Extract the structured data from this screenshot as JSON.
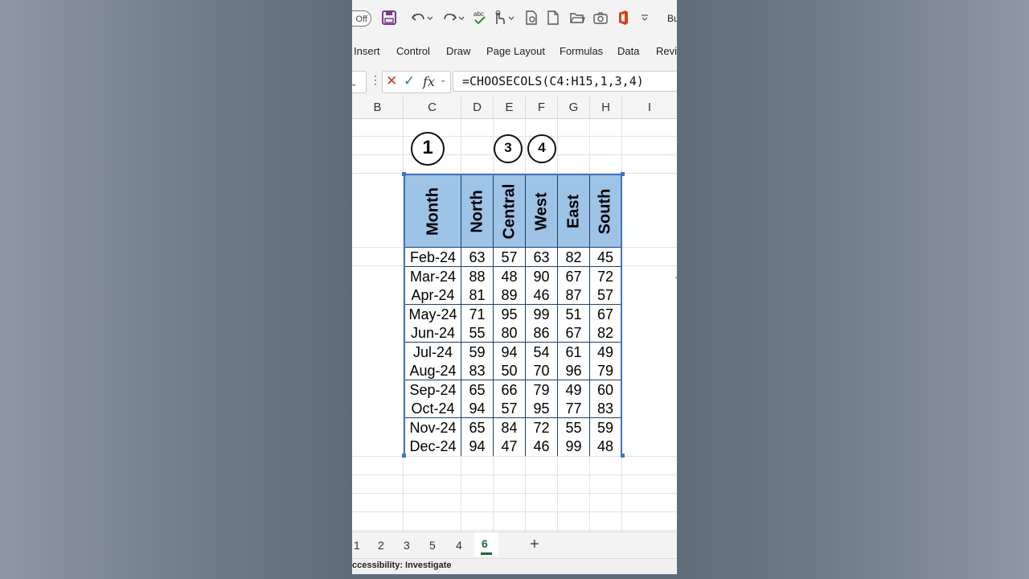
{
  "qat": {
    "autosave_state": "Off",
    "trailing_label": "Bu",
    "icons": [
      "save-icon",
      "undo-icon",
      "redo-icon",
      "spellcheck-icon",
      "touch-mode-icon",
      "print-preview-icon",
      "new-file-icon",
      "open-folder-icon",
      "camera-icon",
      "office-icon",
      "customize-icon"
    ]
  },
  "ribbon": {
    "tabs": [
      "Insert",
      "Control",
      "Draw",
      "Page Layout",
      "Formulas",
      "Data",
      "Revie"
    ]
  },
  "formula_bar": {
    "fx": "fx",
    "formula": "=CHOOSECOLS(C4:H15,1,3,4)"
  },
  "columns": [
    "B",
    "C",
    "D",
    "E",
    "F",
    "G",
    "H",
    "I"
  ],
  "annotations": [
    "1",
    "3",
    "4"
  ],
  "table": {
    "headers": [
      "Month",
      "North",
      "Central",
      "West",
      "East",
      "South"
    ],
    "rows": [
      [
        "Feb-24",
        "63",
        "57",
        "63",
        "82",
        "45"
      ],
      [
        "Mar-24",
        "88",
        "48",
        "90",
        "67",
        "72"
      ],
      [
        "Apr-24",
        "81",
        "89",
        "46",
        "87",
        "57"
      ],
      [
        "May-24",
        "71",
        "95",
        "99",
        "51",
        "67"
      ],
      [
        "Jun-24",
        "55",
        "80",
        "86",
        "67",
        "82"
      ],
      [
        "Jul-24",
        "59",
        "94",
        "54",
        "61",
        "49"
      ],
      [
        "Aug-24",
        "83",
        "50",
        "70",
        "96",
        "79"
      ],
      [
        "Sep-24",
        "65",
        "66",
        "79",
        "49",
        "60"
      ],
      [
        "Oct-24",
        "94",
        "57",
        "95",
        "77",
        "83"
      ],
      [
        "Nov-24",
        "65",
        "84",
        "72",
        "55",
        "59"
      ],
      [
        "Dec-24",
        "94",
        "47",
        "46",
        "99",
        "48"
      ]
    ],
    "header_fill": "#9dc3e6",
    "border_color": "#4472c4"
  },
  "sheets": {
    "tabs": [
      "1",
      "2",
      "3",
      "5",
      "4",
      "6"
    ],
    "active": "6",
    "add_label": "+"
  },
  "status": {
    "text": "ccessibility: Investigate"
  }
}
